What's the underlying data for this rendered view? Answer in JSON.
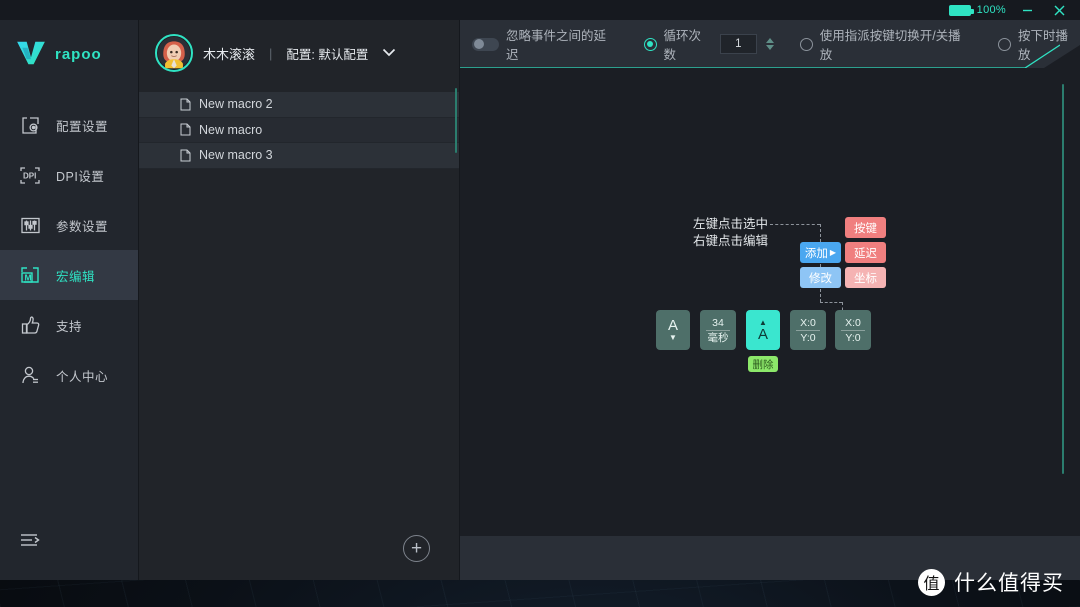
{
  "titlebar": {
    "battery_icon": "battery-full-icon",
    "battery_level": "100%",
    "minimize_label": "minimize-icon",
    "close_label": "close-icon"
  },
  "brand": {
    "logo_icon": "rapoo-v-logo",
    "name": "rapoo",
    "accent": "#2fe3c3"
  },
  "sidebar": {
    "items": [
      {
        "icon": "device-config-icon",
        "label": "配置设置",
        "active": false
      },
      {
        "icon": "dpi-icon",
        "label": "DPI设置",
        "active": false
      },
      {
        "icon": "sliders-icon",
        "label": "参数设置",
        "active": false
      },
      {
        "icon": "macro-m-icon",
        "label": "宏编辑",
        "active": true
      },
      {
        "icon": "thumbs-up-icon",
        "label": "支持",
        "active": false
      },
      {
        "icon": "user-icon",
        "label": "个人中心",
        "active": false
      }
    ],
    "collapse_icon": "collapse-menu-icon"
  },
  "header": {
    "avatar_icon": "user-avatar",
    "username": "木木滚滚",
    "divider": "|",
    "profile_label": "配置: 默认配置",
    "dropdown_icon": "chevron-down-icon"
  },
  "macro_list": {
    "items": [
      {
        "icon": "document-icon",
        "label": "New macro 2"
      },
      {
        "icon": "document-icon",
        "label": "New macro"
      },
      {
        "icon": "document-icon",
        "label": "New macro 3"
      }
    ],
    "add_button_icon": "plus-circle-icon",
    "add_button_label": "+"
  },
  "toolbar": {
    "ignore_delay": {
      "label": "忽略事件之间的延迟",
      "toggle_icon": "toggle-off-switch",
      "on": false
    },
    "loop_count": {
      "label": "循环次数",
      "selected": true,
      "value": "1",
      "radio_icon": "radio-selected-icon",
      "spinner_icon": "spinner-arrows-icon"
    },
    "toggle_playback": {
      "label": "使用指派按键切换开/关播放",
      "selected": false,
      "radio_icon": "radio-unselected-icon"
    },
    "play_on_press": {
      "label": "按下时播放",
      "selected": false,
      "radio_icon": "radio-unselected-icon"
    }
  },
  "editor": {
    "hint_line1": "左键点击选中",
    "hint_line2": "右键点击编辑",
    "context_menu": [
      {
        "label": "添加",
        "caret": "▶",
        "color": "#4aa7f0",
        "name": "add"
      },
      {
        "label": "修改",
        "caret": "",
        "color": "#8ec5f5",
        "name": "modify"
      }
    ],
    "submenu": [
      {
        "label": "按键",
        "color": "#f07f7f",
        "name": "key"
      },
      {
        "label": "延迟",
        "color": "#f07f7f",
        "name": "delay"
      },
      {
        "label": "坐标",
        "color": "#f5b3b3",
        "name": "coordinate"
      }
    ],
    "nodes": [
      {
        "type": "key-down",
        "big": "A",
        "tri": "▼",
        "tri_pos": "bottom",
        "selected": false
      },
      {
        "type": "delay",
        "top": "34",
        "bot": "毫秒",
        "selected": false
      },
      {
        "type": "key-up",
        "big": "A",
        "tri": "▲",
        "tri_pos": "top",
        "selected": true
      },
      {
        "type": "coordinate",
        "top": "X:0",
        "bot": "Y:0",
        "selected": false
      },
      {
        "type": "coordinate",
        "top": "X:0",
        "bot": "Y:0",
        "selected": false
      }
    ],
    "delete_button": "删除"
  },
  "watermark": {
    "badge": "值",
    "text": "什么值得买"
  }
}
